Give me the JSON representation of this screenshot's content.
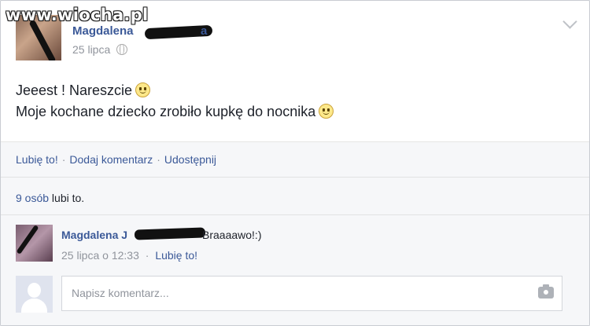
{
  "watermark": "www.wiocha.pl",
  "post": {
    "author": "Magdalena",
    "author_suffix": "a",
    "date": "25 lipca",
    "line1": "Jeeest ! Nareszcie",
    "line2": "Moje kochane dziecko zrobiło kupkę do nocnika"
  },
  "actions": {
    "like": "Lubię to!",
    "comment": "Dodaj komentarz",
    "share": "Udostępnij",
    "separator": "·"
  },
  "likes": {
    "count_link": "9 osób",
    "suffix": " lubi to."
  },
  "comment": {
    "author": "Magdalena J",
    "text": "Braaaawo!:)",
    "time": "25 lipca o 12:33",
    "separator": "·",
    "like": "Lubię to!"
  },
  "composer": {
    "placeholder": "Napisz komentarz..."
  },
  "icons": {
    "privacy": "globe-icon",
    "menu": "chevron-down-icon",
    "emoji": "smiley-icon",
    "photo": "camera-icon"
  }
}
